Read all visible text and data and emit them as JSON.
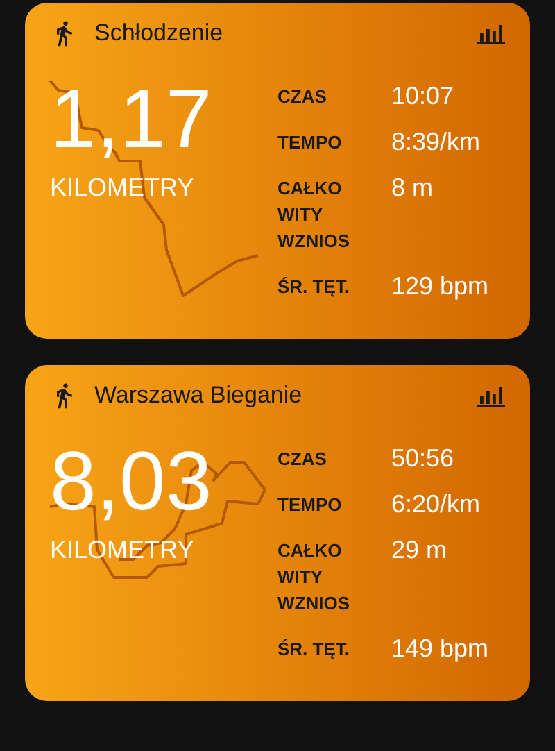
{
  "activities": [
    {
      "title": "Schłodzenie",
      "distance": "1,17",
      "unit": "KILOMETRY",
      "stats": [
        {
          "label": "CZAS",
          "value": "10:07"
        },
        {
          "label": "TEMPO",
          "value": "8:39/km"
        },
        {
          "label": "CAŁKO WITY WZNIOS",
          "value": "8 m"
        },
        {
          "label": "ŚR. TĘT.",
          "value": "129 bpm"
        }
      ]
    },
    {
      "title": "Warszawa Bieganie",
      "distance": "8,03",
      "unit": "KILOMETRY",
      "stats": [
        {
          "label": "CZAS",
          "value": "50:56"
        },
        {
          "label": "TEMPO",
          "value": "6:20/km"
        },
        {
          "label": "CAŁKO WITY WZNIOS",
          "value": "29 m"
        },
        {
          "label": "ŚR. TĘT.",
          "value": "149 bpm"
        }
      ]
    }
  ]
}
